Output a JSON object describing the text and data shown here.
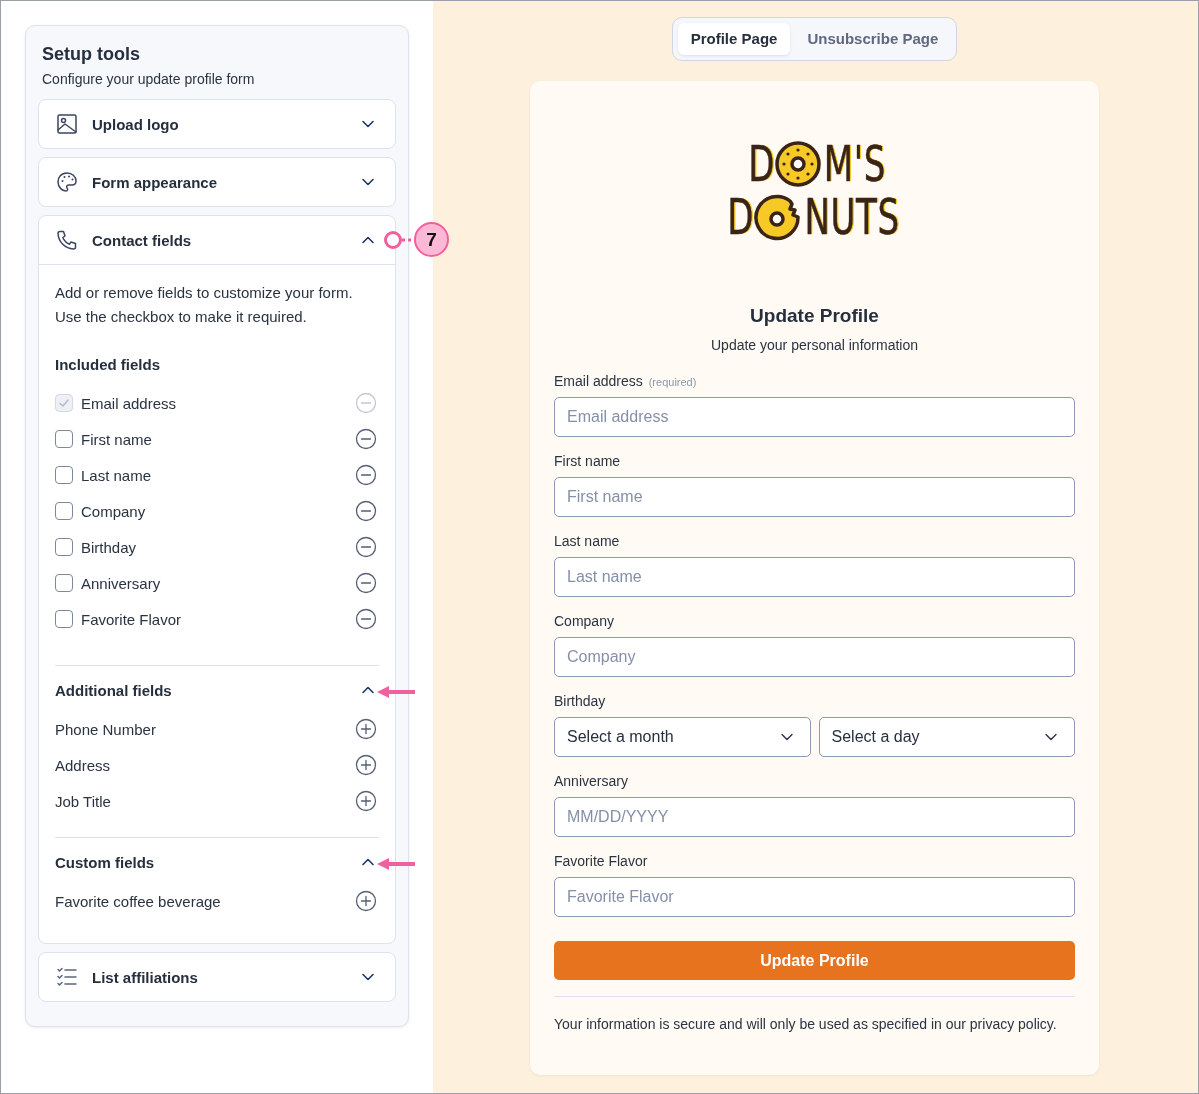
{
  "sidebar": {
    "title": "Setup tools",
    "subtitle": "Configure your update profile form",
    "panels": [
      {
        "label": "Upload logo",
        "kind": "image",
        "expanded": false
      },
      {
        "label": "Form appearance",
        "kind": "palette",
        "expanded": false
      },
      {
        "label": "Contact fields",
        "kind": "phone",
        "expanded": true,
        "callout": "7",
        "description": "Add or remove fields to customize your form. Use the checkbox to make it required.",
        "sections": [
          {
            "title": "Included fields",
            "kind": "included",
            "items": [
              {
                "label": "Email address",
                "checked": true,
                "disabled": true
              },
              {
                "label": "First name",
                "checked": false,
                "disabled": false
              },
              {
                "label": "Last name",
                "checked": false,
                "disabled": false
              },
              {
                "label": "Company",
                "checked": false,
                "disabled": false
              },
              {
                "label": "Birthday",
                "checked": false,
                "disabled": false
              },
              {
                "label": "Anniversary",
                "checked": false,
                "disabled": false
              },
              {
                "label": "Favorite Flavor",
                "checked": false,
                "disabled": false
              }
            ]
          },
          {
            "title": "Additional fields",
            "kind": "available",
            "expanded": true,
            "pointer": true,
            "items": [
              {
                "label": "Phone Number"
              },
              {
                "label": "Address"
              },
              {
                "label": "Job Title"
              }
            ]
          },
          {
            "title": "Custom fields",
            "kind": "available",
            "expanded": true,
            "pointer": true,
            "items": [
              {
                "label": "Favorite coffee beverage"
              }
            ]
          }
        ]
      },
      {
        "label": "List affiliations",
        "kind": "checklist",
        "expanded": false
      }
    ]
  },
  "preview": {
    "tabs": [
      {
        "label": "Profile Page",
        "selected": true
      },
      {
        "label": "Unsubscribe Page",
        "selected": false
      }
    ],
    "logo": {
      "lines": [
        {
          "before": "D",
          "kind": "whole",
          "after": "M'S"
        },
        {
          "before": "D",
          "kind": "bitten",
          "after": "NUTS"
        }
      ]
    },
    "title": "Update Profile",
    "subtitle": "Update your personal information",
    "fields": [
      {
        "label": "Email address",
        "note": "(required)",
        "kind": "text",
        "placeholder": "Email address"
      },
      {
        "label": "First name",
        "kind": "text",
        "placeholder": "First name"
      },
      {
        "label": "Last name",
        "kind": "text",
        "placeholder": "Last name"
      },
      {
        "label": "Company",
        "kind": "text",
        "placeholder": "Company"
      },
      {
        "label": "Birthday",
        "kind": "selects",
        "selects": [
          {
            "value": "Select a month"
          },
          {
            "value": "Select a day"
          }
        ]
      },
      {
        "label": "Anniversary",
        "kind": "text",
        "placeholder": "MM/DD/YYYY"
      },
      {
        "label": "Favorite Flavor",
        "kind": "text",
        "placeholder": "Favorite Flavor"
      }
    ],
    "button": "Update Profile",
    "footer": "Your information is secure and will only be used as specified in our privacy policy."
  }
}
